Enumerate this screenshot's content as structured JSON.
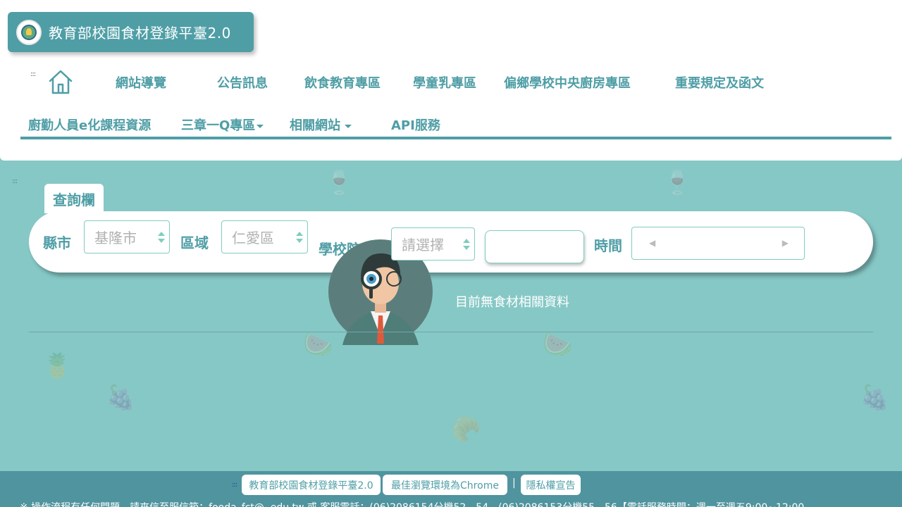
{
  "header": {
    "logo_title": "教育部校園食材登錄平臺2.0",
    "skip_mark": ":::",
    "nav": {
      "home_icon": "home-icon",
      "row1": [
        "網站導覽",
        "公告訊息",
        "飲食教育專區",
        "學童乳專區",
        "偏鄉學校中央廚房專區",
        "重要規定及函文"
      ],
      "row2": [
        "廚勤人員e化課程資源",
        "三章一Q專區",
        "相關網站",
        "API服務"
      ]
    }
  },
  "main": {
    "skip_mark": ":::",
    "query_tab": "查詢欄",
    "city_label": "縣市",
    "city_value": "基隆市",
    "district_label": "區域",
    "district_value": "仁愛區",
    "school_label": "學校院所",
    "school_value": "請選擇",
    "time_label": "時間",
    "date_prev": "◀",
    "date_next": "▶",
    "empty_message": "目前無食材相關資料"
  },
  "footer": {
    "skip_mark": ":::",
    "links": [
      "教育部校園食材登錄平臺2.0",
      "最佳瀏覽環境為Chrome",
      "隱私權宣告"
    ],
    "separator": "|",
    "contact_text": "※ 操作流程有任何問題，請來信至服信箱：fooda_fct@..edu.tw 或 客服電話：(06)2086154分機52、54、(06)2086153分機55、56【電話服務時間：週一至週五9:00~12:00"
  },
  "colors": {
    "accent": "#4f9ea6",
    "background": "#86c8c6",
    "footer": "#4f949f",
    "input_border": "#7fcdbf"
  }
}
